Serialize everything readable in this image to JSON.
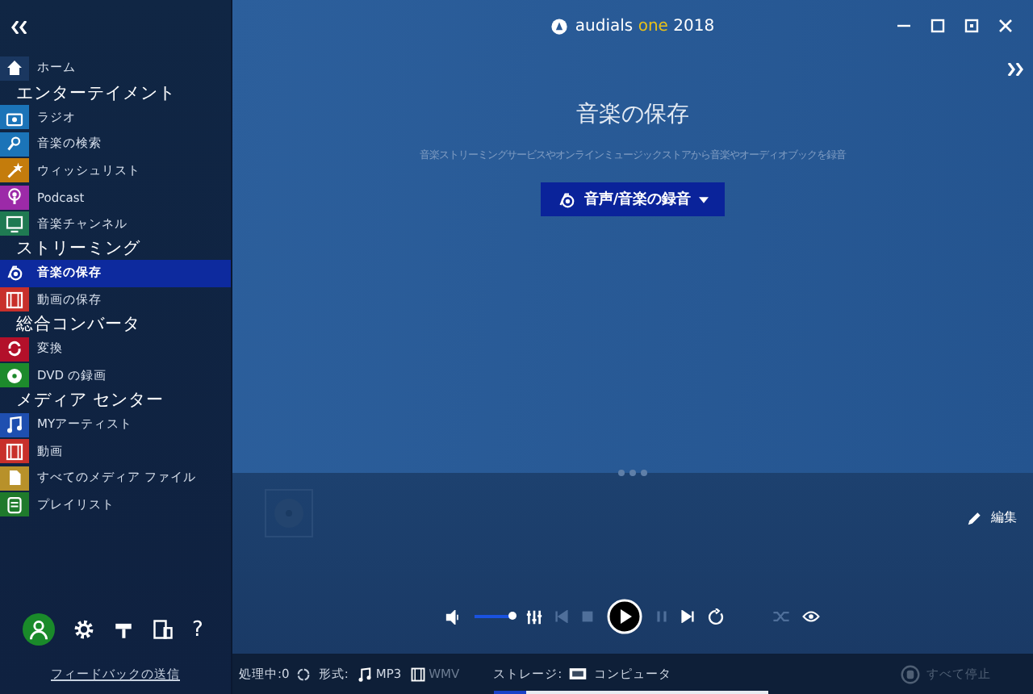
{
  "window": {
    "title_parts": [
      {
        "text": "audials",
        "kind": "plain"
      },
      {
        "text": "one",
        "kind": "accent"
      },
      {
        "text": "2018",
        "kind": "plain"
      }
    ]
  },
  "sidebar": {
    "nav": [
      {
        "kind": "item",
        "label": "ホーム",
        "color": "#1a3760",
        "selected": false
      },
      {
        "kind": "header",
        "label": "エンターテイメント"
      },
      {
        "kind": "item",
        "label": "ラジオ",
        "color": "#1b74b8",
        "selected": false
      },
      {
        "kind": "item",
        "label": "音楽の検索",
        "color": "#1b74b8",
        "selected": false
      },
      {
        "kind": "item",
        "label": "ウィッシュリスト",
        "color": "#c47c0c",
        "selected": false
      },
      {
        "kind": "item",
        "label": "Podcast",
        "color": "#9c2aa8",
        "selected": false
      },
      {
        "kind": "item",
        "label": "音楽チャンネル",
        "color": "#1f7a52",
        "selected": false
      },
      {
        "kind": "header",
        "label": "ストリーミング"
      },
      {
        "kind": "item",
        "label": "音楽の保存",
        "color": "#0d2a9e",
        "selected": true
      },
      {
        "kind": "item",
        "label": "動画の保存",
        "color": "#c8302b",
        "selected": false
      },
      {
        "kind": "header",
        "label": "総合コンバータ"
      },
      {
        "kind": "item",
        "label": "変換",
        "color": "#b3102a",
        "selected": false
      },
      {
        "kind": "item",
        "label": "DVD の録画",
        "color": "#1d8a2c",
        "selected": false
      },
      {
        "kind": "header",
        "label": "メディア センター"
      },
      {
        "kind": "item",
        "label": "MYアーティスト",
        "color": "#1f4fb0",
        "selected": false
      },
      {
        "kind": "item",
        "label": "動画",
        "color": "#c8302b",
        "selected": false
      },
      {
        "kind": "item",
        "label": "すべてのメディア ファイル",
        "color": "#b8912a",
        "selected": false
      },
      {
        "kind": "item",
        "label": "プレイリスト",
        "color": "#1f7a2c",
        "selected": false
      }
    ],
    "bottom_icons": [
      "?"
    ],
    "feedback_link": "フィードバックの送信"
  },
  "main": {
    "title": "音楽の保存",
    "subtitle": "音楽ストリーミングサービスやオンラインミュージックストアから音楽やオーディオブックを録音",
    "record_button": "音声/音楽の録音",
    "edit_button": "編集"
  },
  "player": {
    "volume": {
      "level": 0.95
    }
  },
  "status_bar": {
    "processing": "処理中:0",
    "format_label": "形式:",
    "formats": [
      {
        "label": "MP3",
        "active": true
      },
      {
        "label": "WMV",
        "active": false
      }
    ],
    "storage_label": "ストレージ:",
    "storage_target": "コンピュータ",
    "storage": {
      "level": 0.12
    },
    "stop_all": "すべて停止"
  }
}
